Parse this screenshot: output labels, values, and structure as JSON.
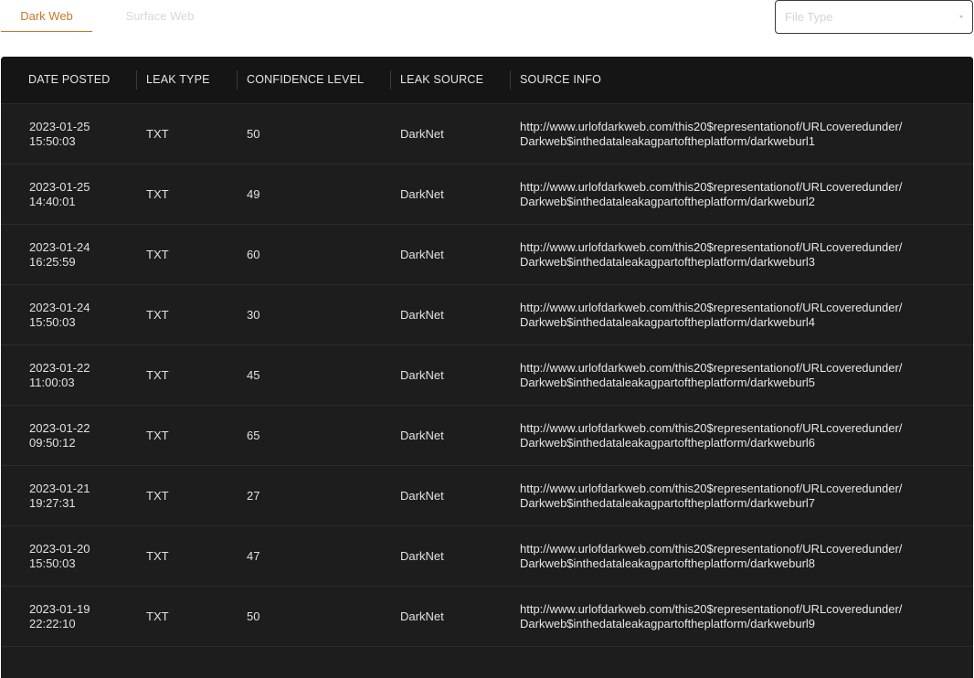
{
  "tabs": [
    {
      "label": "Dark Web",
      "active": true
    },
    {
      "label": "Surface Web",
      "active": false
    }
  ],
  "file_type_select": {
    "placeholder": "File Type"
  },
  "table": {
    "columns": [
      "DATE POSTED",
      "LEAK TYPE",
      "CONFIDENCE LEVEL",
      "LEAK SOURCE",
      "SOURCE INFO"
    ],
    "rows": [
      {
        "date": "2023-01-25",
        "time": "15:50:03",
        "type": "TXT",
        "confidence": "50",
        "source": "DarkNet",
        "info_line1": "http://www.urlofdarkweb.com/this20$representationof/URLcoveredunder/",
        "info_line2": "Darkweb$inthedataleakagpartoftheplatform/darkweburl1"
      },
      {
        "date": "2023-01-25",
        "time": "14:40:01",
        "type": "TXT",
        "confidence": "49",
        "source": "DarkNet",
        "info_line1": "http://www.urlofdarkweb.com/this20$representationof/URLcoveredunder/",
        "info_line2": "Darkweb$inthedataleakagpartoftheplatform/darkweburl2"
      },
      {
        "date": "2023-01-24",
        "time": "16:25:59",
        "type": "TXT",
        "confidence": "60",
        "source": "DarkNet",
        "info_line1": "http://www.urlofdarkweb.com/this20$representationof/URLcoveredunder/",
        "info_line2": "Darkweb$inthedataleakagpartoftheplatform/darkweburl3"
      },
      {
        "date": "2023-01-24",
        "time": "15:50:03",
        "type": "TXT",
        "confidence": "30",
        "source": "DarkNet",
        "info_line1": "http://www.urlofdarkweb.com/this20$representationof/URLcoveredunder/",
        "info_line2": "Darkweb$inthedataleakagpartoftheplatform/darkweburl4"
      },
      {
        "date": "2023-01-22",
        "time": "11:00:03",
        "type": "TXT",
        "confidence": "45",
        "source": "DarkNet",
        "info_line1": "http://www.urlofdarkweb.com/this20$representationof/URLcoveredunder/",
        "info_line2": "Darkweb$inthedataleakagpartoftheplatform/darkweburl5"
      },
      {
        "date": "2023-01-22",
        "time": "09:50:12",
        "type": "TXT",
        "confidence": "65",
        "source": "DarkNet",
        "info_line1": "http://www.urlofdarkweb.com/this20$representationof/URLcoveredunder/",
        "info_line2": "Darkweb$inthedataleakagpartoftheplatform/darkweburl6"
      },
      {
        "date": "2023-01-21",
        "time": "19:27:31",
        "type": "TXT",
        "confidence": "27",
        "source": "DarkNet",
        "info_line1": "http://www.urlofdarkweb.com/this20$representationof/URLcoveredunder/",
        "info_line2": "Darkweb$inthedataleakagpartoftheplatform/darkweburl7"
      },
      {
        "date": "2023-01-20",
        "time": "15:50:03",
        "type": "TXT",
        "confidence": "47",
        "source": "DarkNet",
        "info_line1": "http://www.urlofdarkweb.com/this20$representationof/URLcoveredunder/",
        "info_line2": "Darkweb$inthedataleakagpartoftheplatform/darkweburl8"
      },
      {
        "date": "2023-01-19",
        "time": "22:22:10",
        "type": "TXT",
        "confidence": "50",
        "source": "DarkNet",
        "info_line1": "http://www.urlofdarkweb.com/this20$representationof/URLcoveredunder/",
        "info_line2": "Darkweb$inthedataleakagpartoftheplatform/darkweburl9"
      }
    ]
  },
  "colors": {
    "accent": "#c8772a",
    "panel_bg": "#1d1d1d",
    "header_bg": "#151515"
  }
}
